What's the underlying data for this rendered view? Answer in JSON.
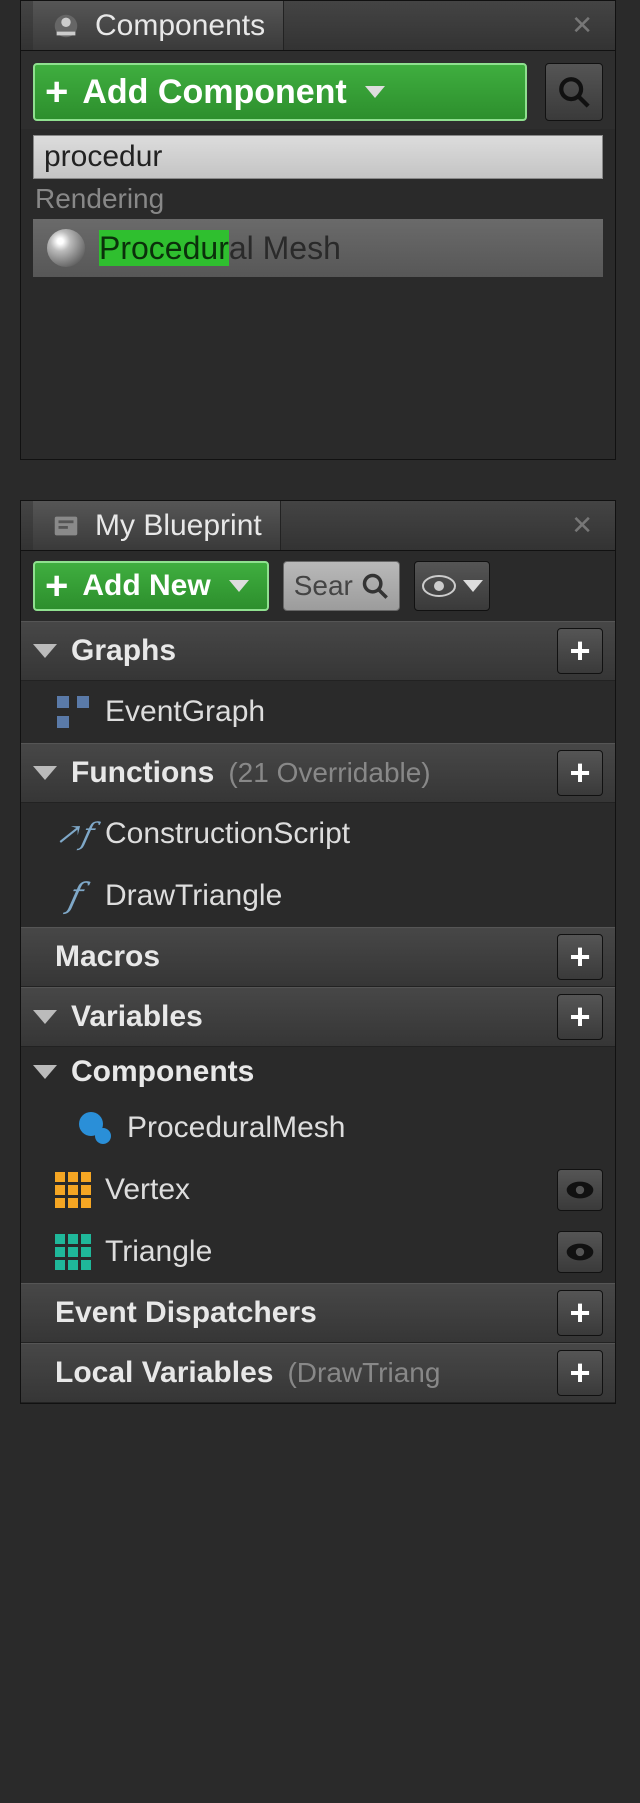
{
  "colors": {
    "accent_green": "#3fae3f",
    "highlight": "#2fbf2f",
    "orange": "#f5a623",
    "teal": "#1fb89a"
  },
  "components_panel": {
    "title": "Components",
    "add_btn": "Add Component",
    "search_value": "procedur",
    "category": "Rendering",
    "result": {
      "highlight": "Procedur",
      "rest": "al Mesh",
      "full": "Procedural Mesh"
    }
  },
  "blueprint_panel": {
    "title": "My Blueprint",
    "add_btn": "Add New",
    "search_placeholder": "Sear",
    "sections": {
      "graphs": {
        "label": "Graphs",
        "items": [
          {
            "label": "EventGraph"
          }
        ]
      },
      "functions": {
        "label": "Functions",
        "hint": "(21 Overridable)",
        "items": [
          {
            "label": "ConstructionScript"
          },
          {
            "label": "DrawTriangle"
          }
        ]
      },
      "macros": {
        "label": "Macros",
        "items": []
      },
      "variables": {
        "label": "Variables",
        "items": []
      },
      "components_sub": {
        "label": "Components",
        "items": [
          {
            "label": "ProceduralMesh",
            "icon": "sphere-blue"
          },
          {
            "label": "Vertex",
            "icon": "grid-orange",
            "has_eye": true
          },
          {
            "label": "Triangle",
            "icon": "grid-teal",
            "has_eye": true
          }
        ]
      },
      "dispatchers": {
        "label": "Event Dispatchers",
        "items": []
      },
      "local_vars": {
        "label": "Local Variables",
        "hint": "(DrawTriang"
      }
    }
  }
}
